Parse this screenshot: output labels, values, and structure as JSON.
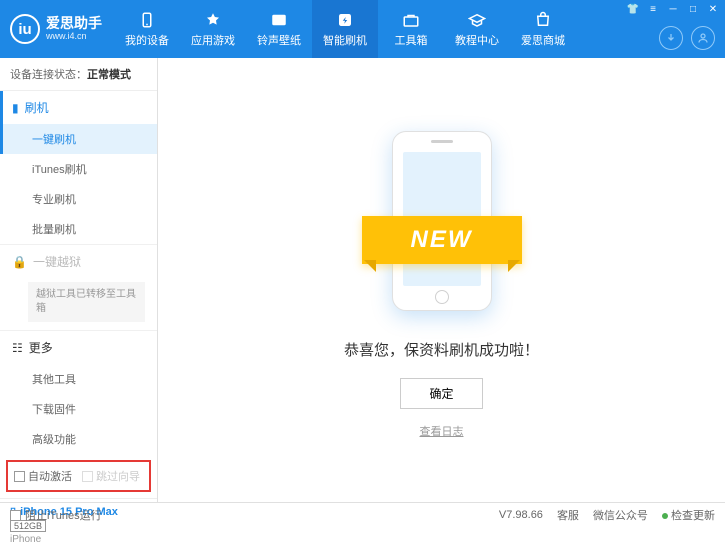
{
  "logo": {
    "icon": "iu",
    "title": "爱思助手",
    "sub": "www.i4.cn"
  },
  "nav": [
    {
      "label": "我的设备"
    },
    {
      "label": "应用游戏"
    },
    {
      "label": "铃声壁纸"
    },
    {
      "label": "智能刷机"
    },
    {
      "label": "工具箱"
    },
    {
      "label": "教程中心"
    },
    {
      "label": "爱思商城"
    }
  ],
  "status": {
    "label": "设备连接状态：",
    "value": "正常模式"
  },
  "sidebar": {
    "flash": {
      "head": "刷机",
      "items": [
        "一键刷机",
        "iTunes刷机",
        "专业刷机",
        "批量刷机"
      ]
    },
    "jailbreak": {
      "head": "一键越狱",
      "notice": "越狱工具已转移至工具箱"
    },
    "more": {
      "head": "更多",
      "items": [
        "其他工具",
        "下载固件",
        "高级功能"
      ]
    }
  },
  "checkboxes": {
    "auto_activate": "自动激活",
    "skip_guide": "跳过向导"
  },
  "device": {
    "name": "iPhone 15 Pro Max",
    "storage": "512GB",
    "type": "iPhone"
  },
  "main": {
    "ribbon": "NEW",
    "success": "恭喜您，保资料刷机成功啦！",
    "ok": "确定",
    "log": "查看日志"
  },
  "footer": {
    "block_itunes": "阻止iTunes运行",
    "version": "V7.98.66",
    "links": [
      "客服",
      "微信公众号",
      "检查更新"
    ]
  }
}
